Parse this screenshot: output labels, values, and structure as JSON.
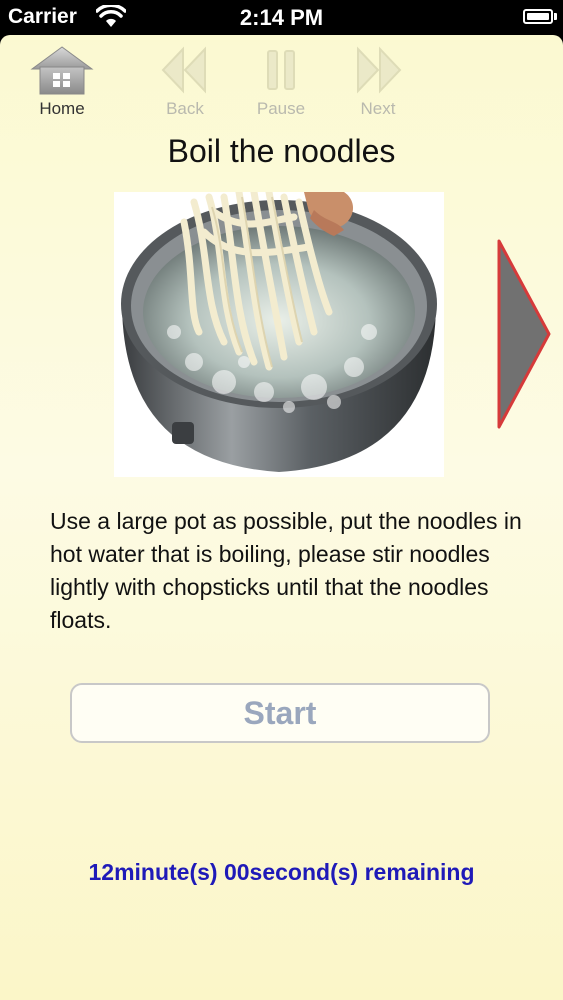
{
  "status_bar": {
    "carrier": "Carrier",
    "time": "2:14 PM",
    "wifi_icon": "wifi-icon",
    "battery_icon": "battery-icon"
  },
  "toolbar": {
    "home": {
      "label": "Home",
      "icon": "house-icon",
      "enabled": true
    },
    "back": {
      "label": "Back",
      "icon": "rewind-icon",
      "enabled": false
    },
    "pause": {
      "label": "Pause",
      "icon": "pause-icon",
      "enabled": false
    },
    "next": {
      "label": "Next",
      "icon": "fast-forward-icon",
      "enabled": false
    }
  },
  "step": {
    "title": "Boil the noodles",
    "image": "photo of hands lowering fresh udon noodles into a pot of boiling water",
    "instructions": "Use a large pot as possible,  put the noodles in hot water that is boiling, please stir noodles lightly with chopsticks until that the noodles floats."
  },
  "controls": {
    "start_label": "Start",
    "next_step_icon": "next-step-arrow-icon"
  },
  "timer": {
    "text": "12minute(s) 00second(s) remaining"
  },
  "colors": {
    "background": "#fbf9d1",
    "timer_text": "#1f1ab8",
    "start_text": "#9aa7bd",
    "arrow_fill": "#707070",
    "arrow_border": "#d63a3a"
  }
}
